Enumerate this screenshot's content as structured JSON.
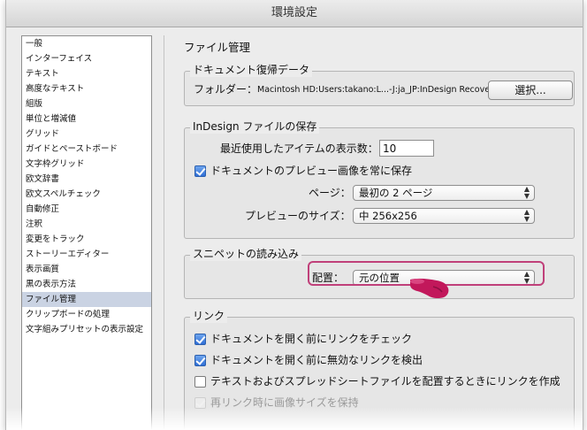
{
  "window": {
    "title": "環境設定"
  },
  "sidebar": {
    "items": [
      {
        "label": "一般"
      },
      {
        "label": "インターフェイス"
      },
      {
        "label": "テキスト"
      },
      {
        "label": "高度なテキスト"
      },
      {
        "label": "組版"
      },
      {
        "label": "単位と増減値"
      },
      {
        "label": "グリッド"
      },
      {
        "label": "ガイドとペーストボード"
      },
      {
        "label": "文字枠グリッド"
      },
      {
        "label": "欧文辞書"
      },
      {
        "label": "欧文スペルチェック"
      },
      {
        "label": "自動修正"
      },
      {
        "label": "注釈"
      },
      {
        "label": "変更をトラック"
      },
      {
        "label": "ストーリーエディター"
      },
      {
        "label": "表示画質"
      },
      {
        "label": "黒の表示方法"
      },
      {
        "label": "ファイル管理"
      },
      {
        "label": "クリップボードの処理"
      },
      {
        "label": "文字組みプリセットの表示設定"
      }
    ],
    "selected_index": 17
  },
  "main": {
    "title": "ファイル管理",
    "recovery": {
      "title": "ドキュメント復帰データ",
      "folder_label": "フォルダー：",
      "folder_path": "Macintosh HD:Users:takano:L...-J:ja_JP:InDesign Recovery",
      "choose_button": "選択..."
    },
    "save": {
      "title": "InDesign ファイルの保存",
      "recent_label": "最近使用したアイテムの表示数：",
      "recent_value": "10",
      "preview_checkbox": "ドキュメントのプレビュー画像を常に保存",
      "preview_checked": true,
      "pages_label": "ページ：",
      "pages_value": "最初の 2 ページ",
      "size_label": "プレビューのサイズ：",
      "size_value": "中 256x256"
    },
    "snippet": {
      "title": "スニペットの読み込み",
      "placement_label": "配置：",
      "placement_value": "元の位置"
    },
    "links": {
      "title": "リンク",
      "items": [
        {
          "label": "ドキュメントを開く前にリンクをチェック",
          "checked": true,
          "disabled": false
        },
        {
          "label": "ドキュメントを開く前に無効なリンクを検出",
          "checked": true,
          "disabled": false
        },
        {
          "label": "テキストおよびスプレッドシートファイルを配置するときにリンクを作成",
          "checked": false,
          "disabled": false
        },
        {
          "label": "再リンク時に画像サイズを保持",
          "checked": true,
          "disabled": true
        }
      ]
    }
  },
  "colors": {
    "highlight": "#c0407a",
    "pointer": "#c2185b",
    "selection": "#cad3e3"
  },
  "icons": {
    "pointer": "pointing-hand-icon",
    "select_arrows": "updown-arrows-icon"
  }
}
